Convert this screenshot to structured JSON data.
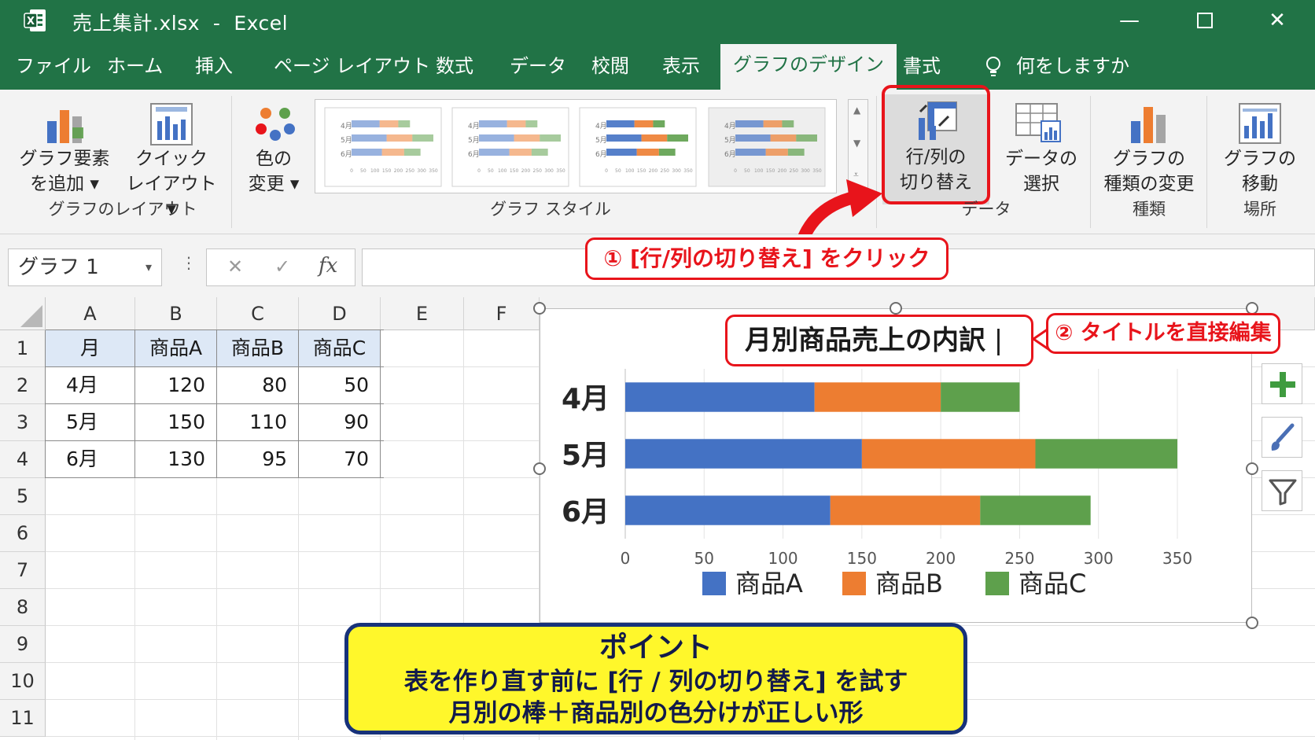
{
  "window": {
    "filename": "売上集計.xlsx",
    "separator": "-",
    "app": "Excel"
  },
  "tabs": [
    "ファイル",
    "ホーム",
    "挿入",
    "ページ レイアウト",
    "数式",
    "データ",
    "校閲",
    "表示",
    "グラフのデザイン",
    "書式"
  ],
  "active_tab": "グラフのデザイン",
  "tell_me": "何をしますか",
  "ribbon": {
    "add_element": [
      "グラフ要素",
      "を追加"
    ],
    "quick_layout": [
      "クイック",
      "レイアウト"
    ],
    "change_colors": [
      "色の",
      "変更"
    ],
    "group_layout": "グラフのレイアウト",
    "group_styles": "グラフ スタイル",
    "switch_row_col": [
      "行/列の",
      "切り替え"
    ],
    "select_data": [
      "データの",
      "選択"
    ],
    "group_data": "データ",
    "change_type": [
      "グラフの",
      "種類の変更"
    ],
    "group_type": "種類",
    "move_chart": [
      "グラフの",
      "移動"
    ],
    "group_location": "場所",
    "style_thumb_labels": [
      "4月",
      "5月",
      "6月"
    ],
    "style_thumb_ticks": [
      "0",
      "50",
      "100",
      "150",
      "200",
      "250",
      "300",
      "350"
    ]
  },
  "formula_bar": {
    "name_box": "グラフ 1",
    "fx": "fx",
    "cancel": "✕",
    "enter": "✓"
  },
  "sheet": {
    "columns": [
      "A",
      "B",
      "C",
      "D",
      "E",
      "F"
    ],
    "rows": [
      "1",
      "2",
      "3",
      "4",
      "5",
      "6",
      "7",
      "8",
      "9",
      "10",
      "11"
    ],
    "table": {
      "header": [
        "月",
        "商品A",
        "商品B",
        "商品C"
      ],
      "body": [
        [
          "4月",
          "120",
          "80",
          "50"
        ],
        [
          "5月",
          "150",
          "110",
          "90"
        ],
        [
          "6月",
          "130",
          "95",
          "70"
        ]
      ]
    }
  },
  "chart_data": {
    "type": "bar",
    "orientation": "horizontal",
    "stacked": true,
    "title": "月別商品売上の内訳",
    "categories": [
      "4月",
      "5月",
      "6月"
    ],
    "series": [
      {
        "name": "商品A",
        "values": [
          120,
          150,
          130
        ],
        "color": "#4472c4"
      },
      {
        "name": "商品B",
        "values": [
          80,
          110,
          95
        ],
        "color": "#ed7d31"
      },
      {
        "name": "商品C",
        "values": [
          50,
          90,
          70
        ],
        "color": "#5ea04c"
      }
    ],
    "xlim": [
      0,
      350
    ],
    "xticks": [
      "0",
      "50",
      "100",
      "150",
      "200",
      "250",
      "300",
      "350"
    ],
    "grid": true,
    "legend": "bottom"
  },
  "annotations": {
    "step1": "① [行/列の切り替え] をクリック",
    "step2": "② タイトルを直接編集",
    "point_title": "ポイント",
    "point_line1": "表を作り直す前に [行 / 列の切り替え] を試す",
    "point_line2": "月別の棒＋商品別の色分けが正しい形",
    "accent_red": "#e8141b",
    "excel_green": "#217346"
  }
}
